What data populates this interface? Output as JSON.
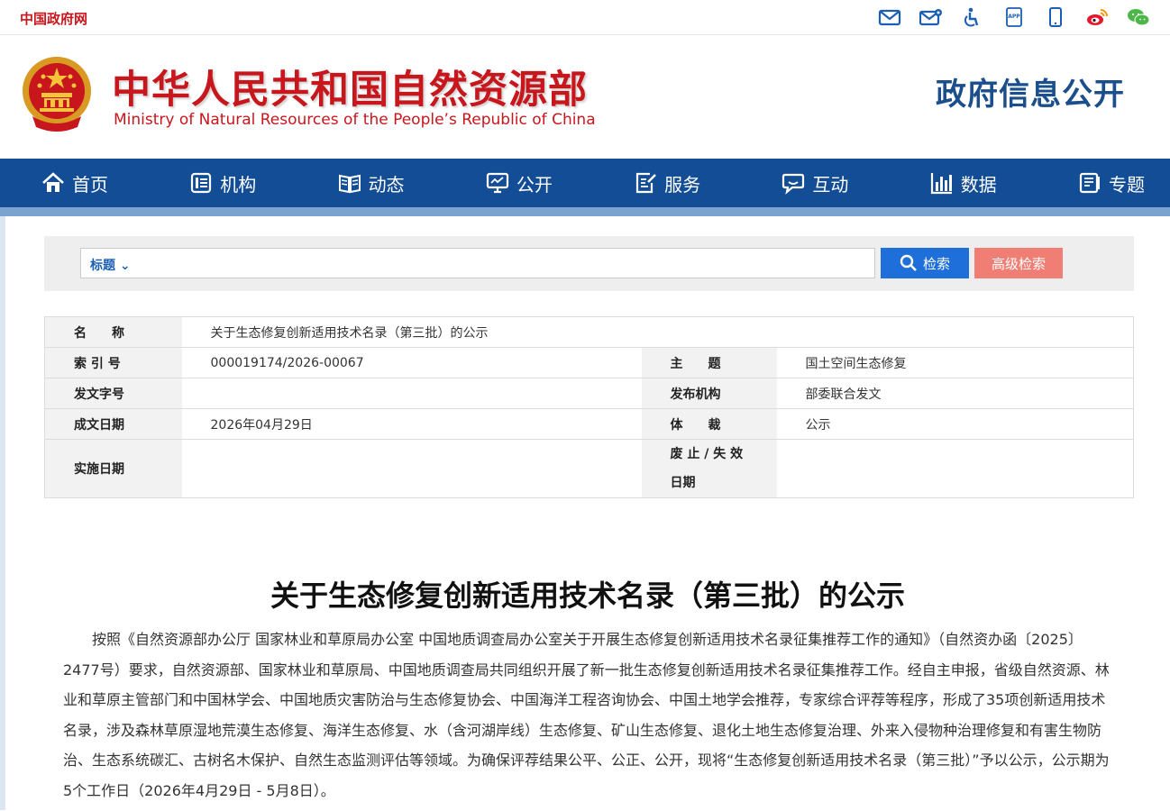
{
  "topbar": {
    "gov_link": "中国政府网",
    "icons": [
      "mail-icon",
      "mail-settings-icon",
      "accessibility-icon",
      "app-icon",
      "mobile-icon",
      "weibo-icon",
      "wechat-icon"
    ],
    "app_text": "APP"
  },
  "banner": {
    "title_cn": "中华人民共和国自然资源部",
    "title_en": "Ministry of Natural Resources of the People’s Republic of China",
    "gov_open": "政府信息公开"
  },
  "nav": {
    "items": [
      {
        "label": "首页",
        "icon": "home-icon"
      },
      {
        "label": "机构",
        "icon": "org-icon"
      },
      {
        "label": "动态",
        "icon": "book-icon"
      },
      {
        "label": "公开",
        "icon": "monitor-icon"
      },
      {
        "label": "服务",
        "icon": "edit-icon"
      },
      {
        "label": "互动",
        "icon": "chat-icon"
      },
      {
        "label": "数据",
        "icon": "bar-chart-icon"
      },
      {
        "label": "专题",
        "icon": "document-icon"
      }
    ]
  },
  "search": {
    "type_label": "标题",
    "placeholder": "",
    "search_label": "检索",
    "advanced_label": "高级检索"
  },
  "meta": {
    "name_label": "名　　称",
    "name_value": "关于生态修复创新适用技术名录（第三批）的公示",
    "index_label": "索 引 号",
    "index_value": "000019174/2026-00067",
    "subject_label": "主　　题",
    "subject_value": "国土空间生态修复",
    "docno_label": "发文字号",
    "docno_value": "",
    "org_label": "发布机构",
    "org_value": "部委联合发文",
    "date_label": "成文日期",
    "date_value": "2026年04月29日",
    "genre_label": "体　　裁",
    "genre_value": "公示",
    "impl_label": "实施日期",
    "impl_value": "",
    "abolish_label_1": "废 止 / 失 效",
    "abolish_label_2": "日期",
    "abolish_value": ""
  },
  "article": {
    "title": "关于生态修复创新适用技术名录（第三批）的公示",
    "body": "按照《自然资源部办公厅 国家林业和草原局办公室 中国地质调查局办公室关于开展生态修复创新适用技术名录征集推荐工作的通知》（自然资办函〔2025〕2477号）要求，自然资源部、国家林业和草原局、中国地质调查局共同组织开展了新一批生态修复创新适用技术名录征集推荐工作。经自主申报，省级自然资源、林业和草原主管部门和中国林学会、中国地质灾害防治与生态修复协会、中国海洋工程咨询协会、中国土地学会推荐，专家综合评荐等程序，形成了35项创新适用技术名录，涉及森林草原湿地荒漠生态修复、海洋生态修复、水（含河湖岸线）生态修复、矿山生态修复、退化土地生态修复治理、外来入侵物种治理修复和有害生物防治、生态系统碳汇、古树名木保护、自然生态监测评估等领域。为确保评荐结果公平、公正、公开，现将“生态修复创新适用技术名录（第三批）”予以公示，公示期为5个工作日（2026年4月29日 - 5月8日）。"
  },
  "colors": {
    "brand_red": "#c8161d",
    "nav_blue": "#124d96",
    "search_blue": "#1e6fd9",
    "advanced_salmon": "#f07e74"
  }
}
